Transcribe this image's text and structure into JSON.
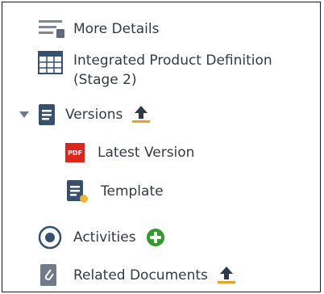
{
  "tree": {
    "more_details": "More Details",
    "product_def_line1": "Integrated Product Definition",
    "product_def_line2": "(Stage 2)",
    "versions": "Versions",
    "latest_version": "Latest Version",
    "pdf_badge": "PDF",
    "template": "Template",
    "activities": "Activities",
    "related_documents": "Related Documents"
  },
  "colors": {
    "accent_blue": "#36506f",
    "icon_gray": "#5f6b7a",
    "pdf_red": "#e0241b",
    "add_green": "#2f9b2a",
    "upload_dark": "#2e3a47",
    "upload_orange": "#f0a21b"
  }
}
